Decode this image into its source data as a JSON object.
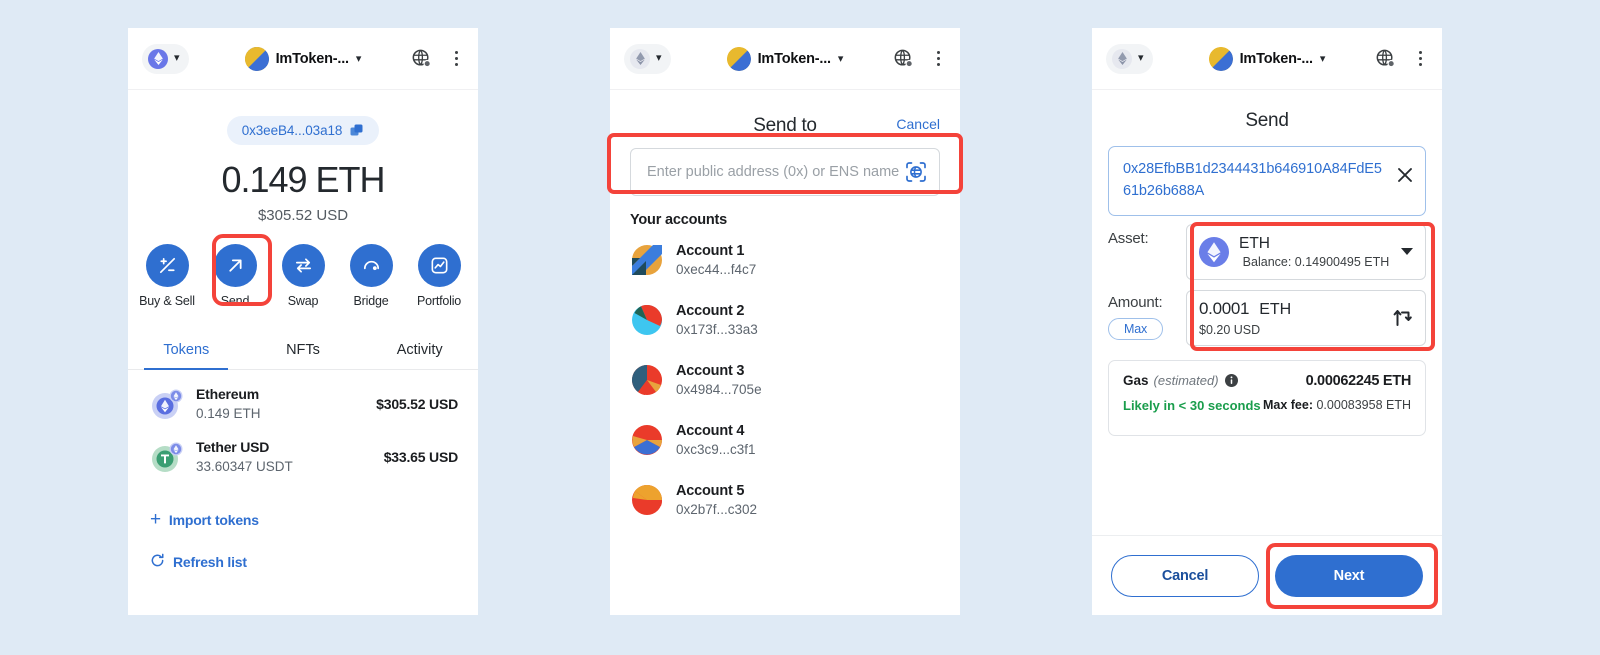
{
  "background_color": "#dfeaf5",
  "accent_color": "#2f6fd0",
  "highlight_color": "#f4433a",
  "topbar": {
    "network_icon": "ethereum-badge-icon",
    "network_chevron": "chevron-down-icon",
    "account_name": "ImToken-...",
    "account_chevron": "chevron-down-icon",
    "globe_icon": "network-globe-icon",
    "menu_icon": "kebab-menu-icon"
  },
  "panel1": {
    "address_pill": "0x3eeB4...03a18",
    "copy_icon": "copy-icon",
    "balance": "0.149 ETH",
    "balance_fiat": "$305.52 USD",
    "actions": [
      {
        "label": "Buy & Sell",
        "icon": "buy-sell-icon"
      },
      {
        "label": "Send",
        "icon": "send-arrow-icon"
      },
      {
        "label": "Swap",
        "icon": "swap-arrows-icon"
      },
      {
        "label": "Bridge",
        "icon": "bridge-icon"
      },
      {
        "label": "Portfolio",
        "icon": "portfolio-chart-icon"
      }
    ],
    "tabs": [
      {
        "label": "Tokens",
        "active": true
      },
      {
        "label": "NFTs",
        "active": false
      },
      {
        "label": "Activity",
        "active": false
      }
    ],
    "tokens": [
      {
        "name": "Ethereum",
        "amount": "0.149 ETH",
        "value": "$305.52 USD",
        "icon": "ethereum-token-icon"
      },
      {
        "name": "Tether USD",
        "amount": "33.60347 USDT",
        "value": "$33.65 USD",
        "icon": "tether-token-icon"
      }
    ],
    "import_tokens": "Import tokens",
    "refresh_list": "Refresh list"
  },
  "panel2": {
    "title": "Send to",
    "cancel": "Cancel",
    "search_placeholder": "Enter public address (0x) or ENS name",
    "search_value": "",
    "scan_icon": "ens-scan-icon",
    "section_title": "Your accounts",
    "accounts": [
      {
        "name": "Account 1",
        "address": "0xec44...f4c7"
      },
      {
        "name": "Account 2",
        "address": "0x173f...33a3"
      },
      {
        "name": "Account 3",
        "address": "0x4984...705e"
      },
      {
        "name": "Account 4",
        "address": "0xc3c9...c3f1"
      },
      {
        "name": "Account 5",
        "address": "0x2b7f...c302"
      }
    ]
  },
  "panel3": {
    "title": "Send",
    "to_address": "0x28EfbBB1d2344431b646910A84FdE561b26b688A",
    "clear_icon": "close-x-icon",
    "asset_label": "Asset:",
    "asset_symbol": "ETH",
    "asset_balance": "Balance: 0.14900495 ETH",
    "asset_icon": "ethereum-circle-icon",
    "asset_caret": "caret-down-icon",
    "amount_label": "Amount:",
    "max_label": "Max",
    "amount_value": "0.0001",
    "amount_symbol": "ETH",
    "amount_fiat": "$0.20 USD",
    "swap_icon": "swap-currency-icon",
    "gas_label": "Gas",
    "gas_estimated": "(estimated)",
    "gas_info_icon": "info-icon",
    "gas_value": "0.00062245 ETH",
    "gas_speed": "Likely in < 30 seconds",
    "gas_max_label": "Max fee:",
    "gas_max_value": "0.00083958 ETH",
    "cancel_button": "Cancel",
    "next_button": "Next"
  }
}
